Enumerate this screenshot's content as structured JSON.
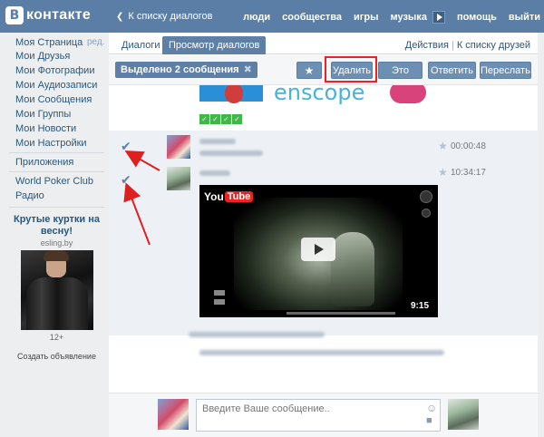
{
  "header": {
    "logo_letter": "В",
    "logo_text": "контакте",
    "back_link": "К списку диалогов",
    "nav": [
      "люди",
      "сообщества",
      "игры",
      "музыка",
      "помощь",
      "выйти"
    ]
  },
  "sidebar": {
    "items": [
      "Моя Страница",
      "Мои Друзья",
      "Мои Фотографии",
      "Мои Аудиозаписи",
      "Мои Сообщения",
      "Мои Группы",
      "Мои Новости",
      "Мои Настройки"
    ],
    "edit_label": "ред.",
    "extra": [
      "Приложения"
    ],
    "apps": [
      "World Poker Club",
      "Радио"
    ],
    "ad": {
      "title": "Крутые куртки на весну!",
      "site": "esling.by",
      "age": "12+",
      "create": "Создать объявление"
    }
  },
  "tabs": {
    "dialogs": "Диалоги",
    "view": "Просмотр диалогов",
    "actions": "Действия",
    "friends": "К списку друзей"
  },
  "toolbar": {
    "selected": "Выделено 2 сообщения",
    "star": "★",
    "delete": "Удалить",
    "spam": "Это спам",
    "reply": "Ответить",
    "forward": "Переслать.."
  },
  "messages": [
    {
      "time": "00:00:48"
    },
    {
      "time": "10:34:17"
    }
  ],
  "video": {
    "logo_you": "You",
    "logo_tube": "Tube",
    "duration": "9:15"
  },
  "composer": {
    "placeholder": "Введите Ваше сообщение.."
  },
  "colors": {
    "header_bg": "#5a7ea5",
    "button_bg": "#6d8fb3",
    "selected_bg": "#edf1f5",
    "highlight": "#e22222",
    "link": "#2b587a"
  }
}
